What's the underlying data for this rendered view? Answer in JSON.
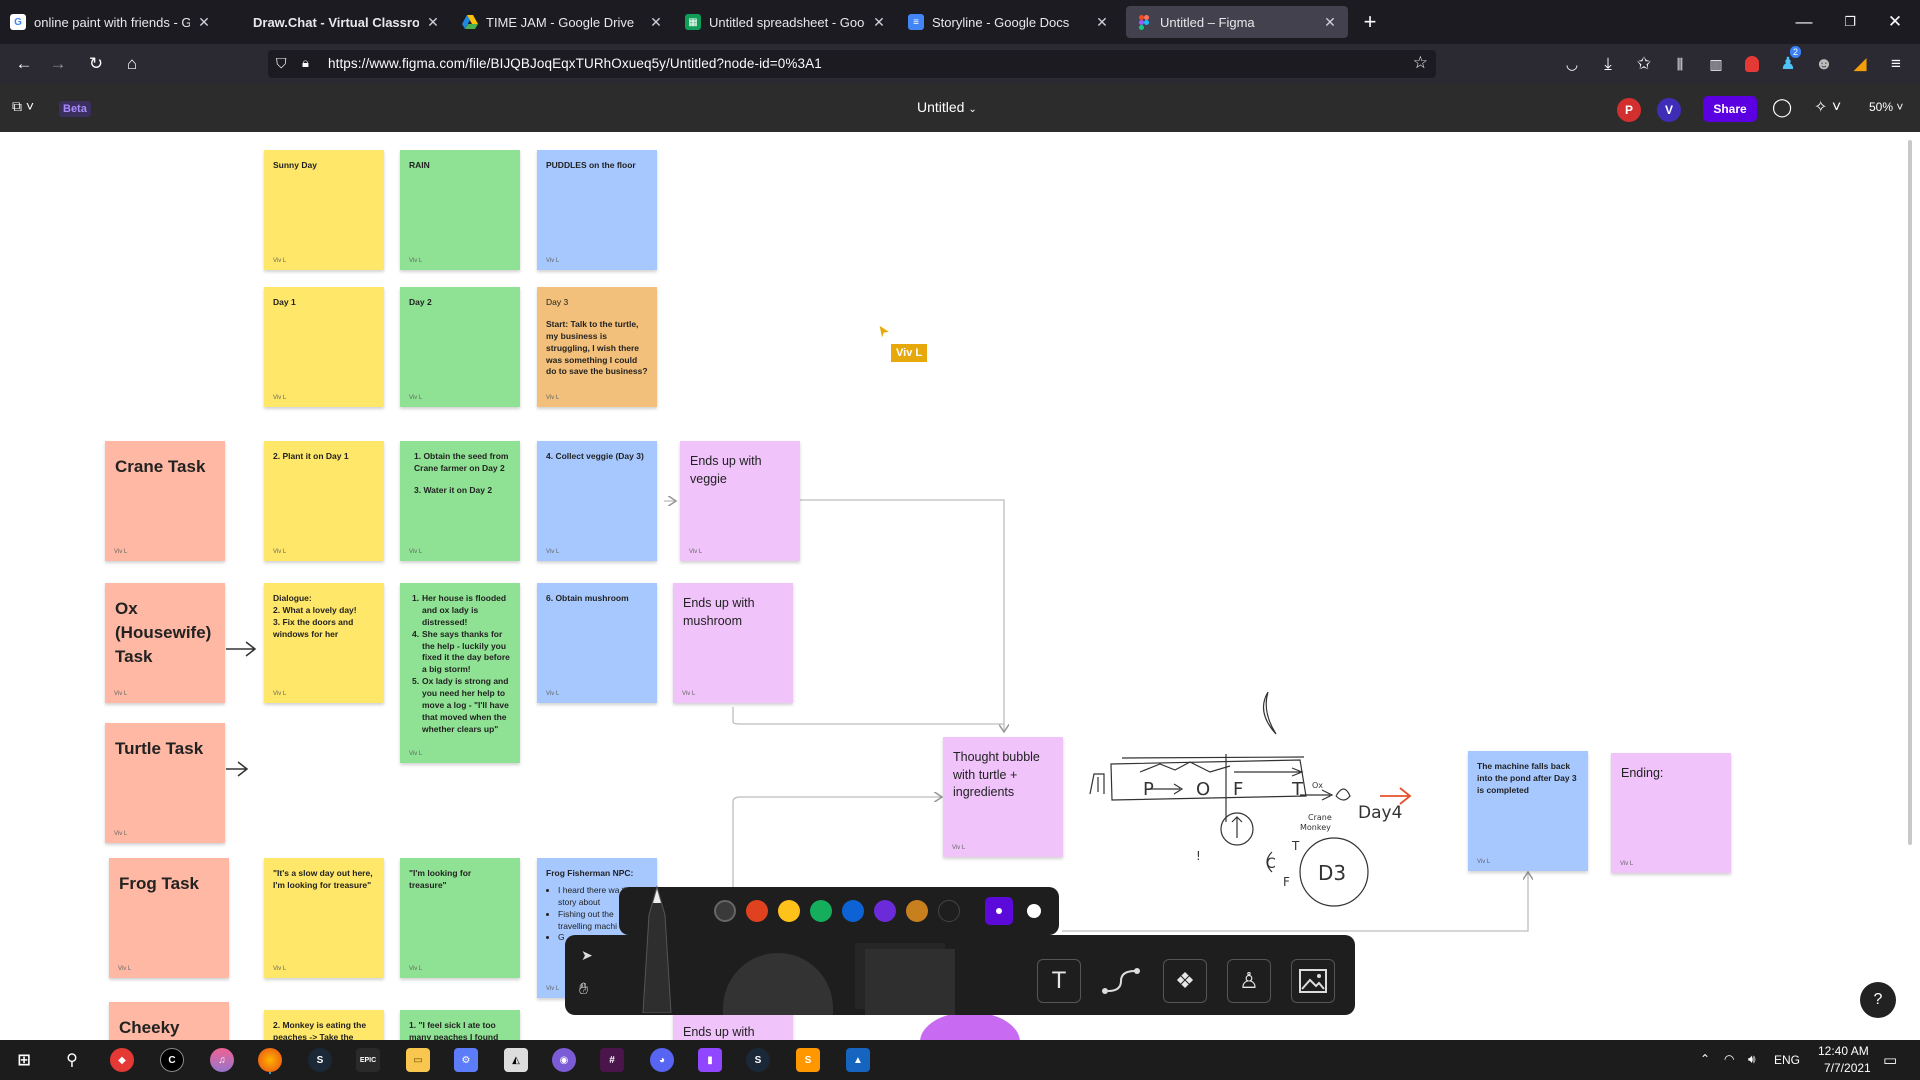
{
  "browser": {
    "tabs": [
      {
        "title": "online paint with friends - Goog",
        "icon": "google-icon",
        "active": false
      },
      {
        "title": "Draw.Chat - Virtual Classroom",
        "icon": "drawchat-icon",
        "active": false
      },
      {
        "title": "TIME JAM - Google Drive",
        "icon": "google-drive-icon",
        "active": false
      },
      {
        "title": "Untitled spreadsheet - Google S",
        "icon": "google-sheets-icon",
        "active": false
      },
      {
        "title": "Storyline - Google Docs",
        "icon": "google-docs-icon",
        "active": false
      },
      {
        "title": "Untitled – Figma",
        "icon": "figma-icon",
        "active": true
      }
    ],
    "new_tab": "+",
    "url": "https://www.figma.com/file/BIJQBJoqEqxTURhOxueq5y/Untitled?node-id=0%3A1",
    "badge_count": "2"
  },
  "figma": {
    "beta_label": "Beta",
    "file_title": "Untitled",
    "avatars": [
      "P",
      "V"
    ],
    "share_label": "Share",
    "zoom": "50%",
    "cursor_user": "Viv L"
  },
  "stickies": {
    "sunny": "Sunny Day",
    "rain": "RAIN",
    "puddles": "PUDDLES on the floor",
    "day1": "Day 1",
    "day2": "Day 2",
    "day3_title": "Day 3",
    "day3_body": "Start: Talk to the turtle, my business is struggling, I wish there was something I could do to save the business?",
    "crane_task": "Crane Task",
    "plant": "2. Plant it on Day 1",
    "obtain_seed": "1. Obtain the seed from Crane farmer on Day 2",
    "water": "3. Water it on Day 2",
    "collect_veggie": "4. Collect veggie (Day 3)",
    "ends_veggie": "Ends up with veggie",
    "ox_task": "Ox (Housewife) Task",
    "ox_dialogue": "Dialogue:\n2. What a lovely day!\n3. Fix the doors and windows for her",
    "ox_list": [
      "Her house is flooded and ox lady is distressed!",
      "She says thanks for the help - luckily you fixed it the day before a big storm!",
      "Ox lady is strong and you need her help to move a log - \"I'll have that moved when the whether clears up\""
    ],
    "ox_list_nums": [
      "1.",
      "4.",
      "5."
    ],
    "obtain_mushroom": "6. Obtain  mushroom",
    "ends_mushroom": "Ends up with mushroom",
    "turtle_task": "Turtle Task",
    "thought_bubble": "Thought bubble with turtle + ingredients",
    "machine": "The machine falls back into the pond after Day 3 is completed",
    "ending": "Ending:",
    "frog_task": "Frog Task",
    "frog_quote1": "\"It's a slow day out here, I'm looking for treasure\"",
    "frog_quote2": "\"I'm looking for treasure\"",
    "frog_npc_title": "Frog Fisherman NPC:",
    "frog_npc_items": [
      "I heard there wa this story about",
      "Fishing out the travelling machi lo ju",
      "G"
    ],
    "cheeky": "Cheeky",
    "monkey": "2. Monkey is eating the peaches -> Take the",
    "sick": "1. \"I feel sick I ate too many peaches I found",
    "ends_up_partial": "Ends up with",
    "author": "Viv L"
  },
  "sketch": {
    "labels": [
      "P",
      "O",
      "F",
      "T",
      "Day4",
      "D3",
      "Crane",
      "Monkey",
      "Ox",
      "C",
      "F",
      "!",
      "T"
    ]
  },
  "toolbar": {
    "colors": [
      "#3a3a3a",
      "#e0411e",
      "#ffc21a",
      "#14ae5c",
      "#0d63d6",
      "#6c2bd9",
      "#c8801e",
      "#1e1e1e"
    ],
    "selected_color": "#5b0ad9",
    "white_swatch": "#ffffff"
  },
  "taskbar": {
    "language": "ENG",
    "time": "12:40 AM",
    "date": "7/7/2021"
  }
}
